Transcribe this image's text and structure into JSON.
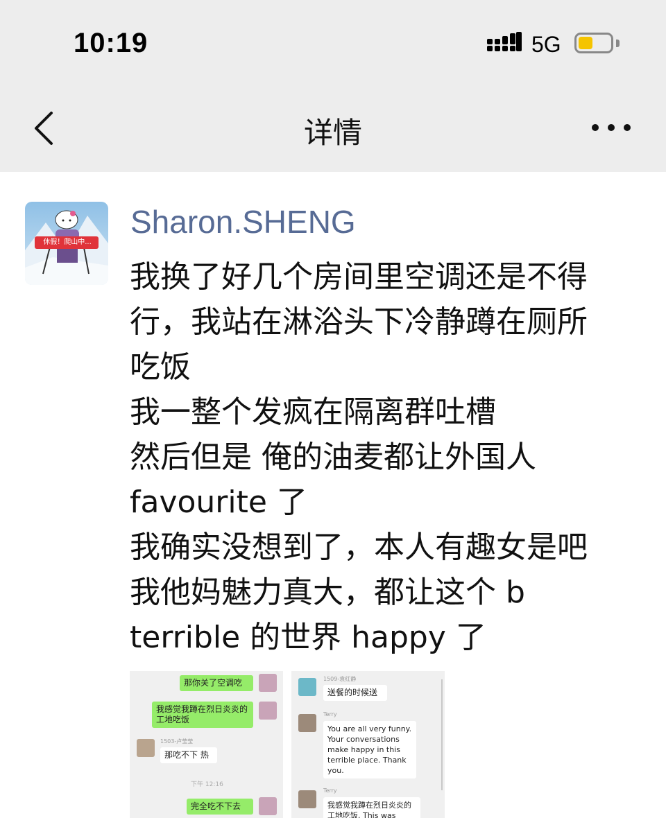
{
  "status_bar": {
    "time": "10:19",
    "network": "5G",
    "battery_level": 0.45,
    "battery_color": "#f5c400"
  },
  "nav": {
    "title": "详情",
    "back_icon": "chevron-left-icon",
    "more_icon": "more-dots-icon"
  },
  "post": {
    "author": "Sharon.SHENG",
    "author_color": "#576b95",
    "avatar_badge": "休假！爬山中...",
    "lines": [
      "我换了好几个房间里空调还是不得",
      "行，我站在淋浴头下冷静蹲在厕所",
      "吃饭",
      "我一整个发疯在隔离群吐槽",
      "然后但是 俺的油麦都让外国人",
      "favourite 了",
      "我确实没想到了，本人有趣女是吧",
      "我他妈魅力真大，都让这个 b",
      "terrible 的世界 happy 了"
    ]
  },
  "thumb1": {
    "msg1": "那你关了空调吃",
    "msg2": "我感觉我蹲在烈日炎炎的工地吃饭",
    "name3": "1503-卢莹莹",
    "msg3": "那吃不下 热",
    "time": "下午 12:16",
    "msg4": "完全吃不下去"
  },
  "thumb2": {
    "name1": "1509-袁红静",
    "msg1": "送餐的时候送",
    "name2": "Terry",
    "msg2": "You are all very funny. Your conversations make happy in this terrible place.  Thank you.",
    "name3": "Terry",
    "msg3": "我感觉我蹲在烈日炎炎的工地吃饭. This was"
  }
}
